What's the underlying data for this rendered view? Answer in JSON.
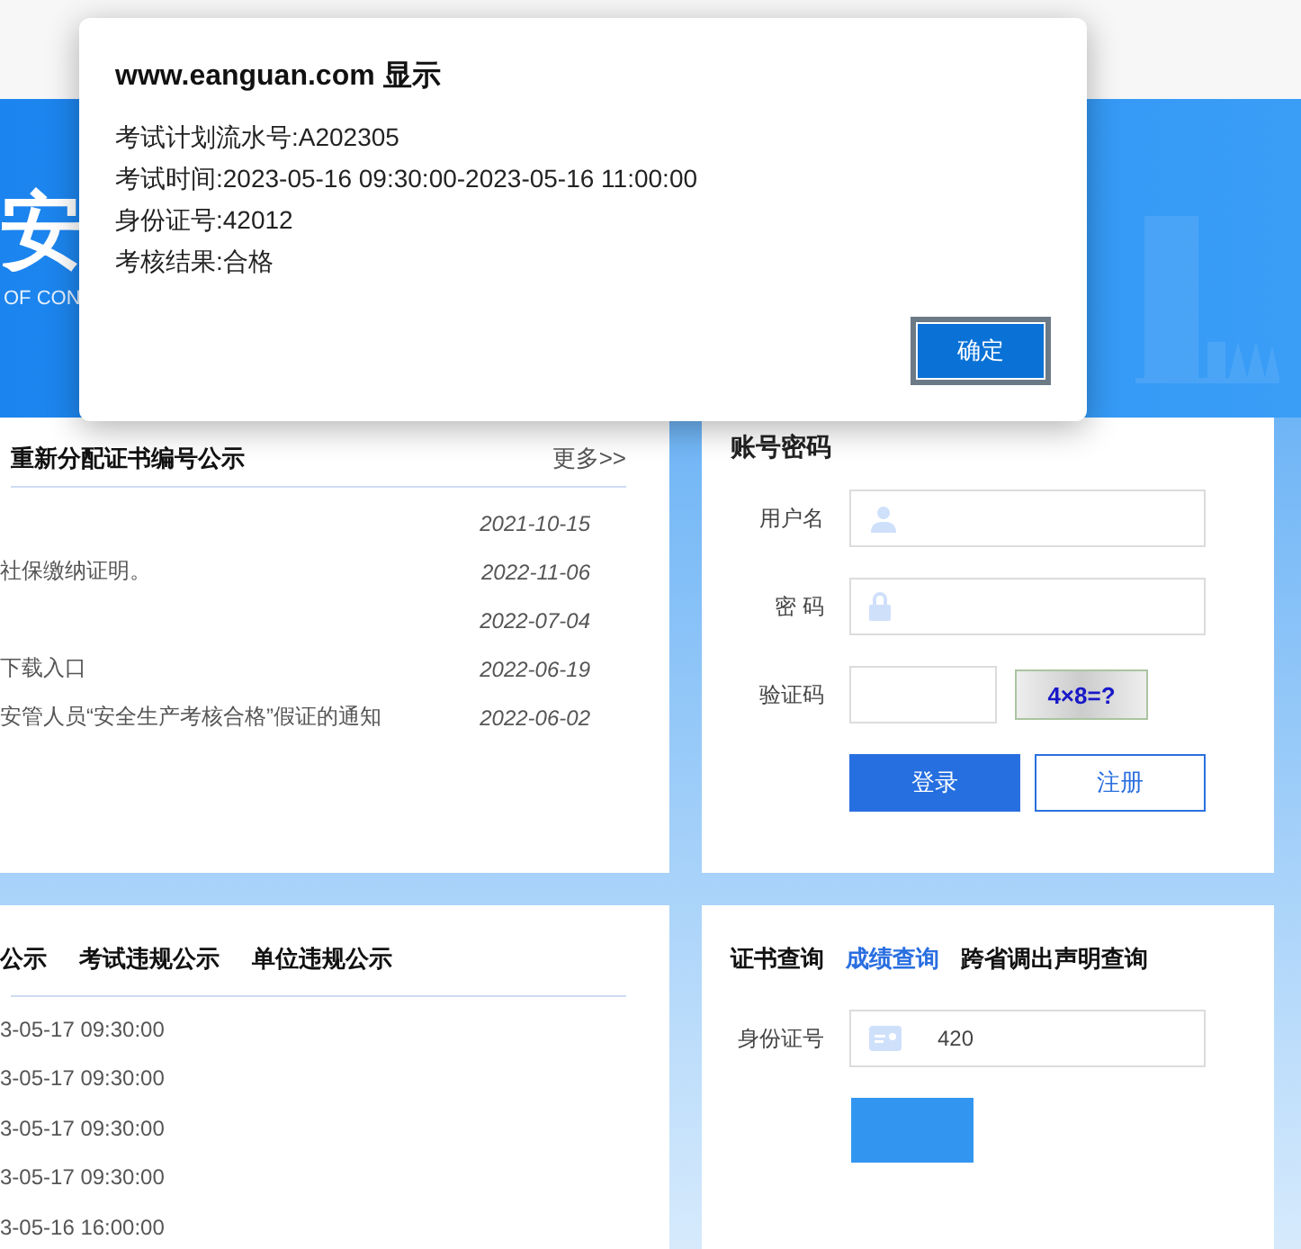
{
  "banner": {
    "title": "安",
    "subtitle": "OF CON"
  },
  "notices": {
    "title": "重新分配证书编号公示",
    "more": "更多>>",
    "rows": [
      {
        "text": "",
        "date": "2021-10-15"
      },
      {
        "text": "社保缴纳证明。",
        "date": "2022-11-06"
      },
      {
        "text": "",
        "date": "2022-07-04"
      },
      {
        "text": "下载入口",
        "date": "2022-06-19"
      },
      {
        "text": "安管人员“安全生产考核合格”假证的通知",
        "date": "2022-06-02"
      }
    ]
  },
  "login": {
    "title": "账号密码",
    "username_label": "用户名",
    "password_label": "密 码",
    "captcha_label": "验证码",
    "captcha": "4×8=?",
    "login_button": "登录",
    "register_button": "注册"
  },
  "announcements": {
    "tabs": [
      "公示",
      "考试违规公示",
      "单位违规公示"
    ],
    "rows": [
      "3-05-17 09:30:00",
      "3-05-17 09:30:00",
      "3-05-17 09:30:00",
      "3-05-17 09:30:00",
      "3-05-16 16:00:00"
    ]
  },
  "query": {
    "tabs": [
      {
        "label": "证书查询",
        "selected": false
      },
      {
        "label": "成绩查询",
        "selected": true
      },
      {
        "label": "跨省调出声明查询",
        "selected": false
      }
    ],
    "id_label": "身份证号",
    "id_value": "420"
  },
  "dialog": {
    "title": "www.eanguan.com 显示",
    "lines": [
      "考试计划流水号:A202305",
      "考试时间:2023-05-16 09:30:00-2023-05-16 11:00:00",
      "身份证号:42012",
      "考核结果:合格"
    ],
    "ok": "确定"
  }
}
